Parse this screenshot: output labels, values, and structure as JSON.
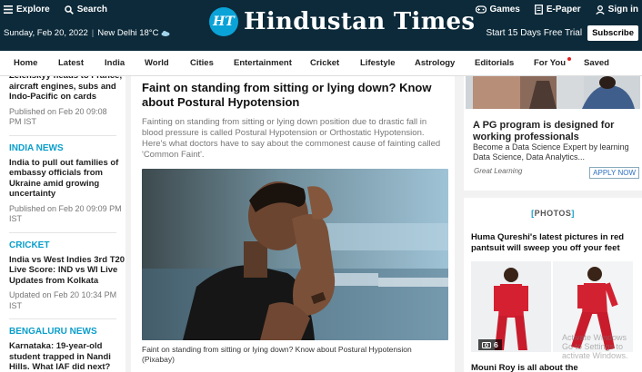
{
  "header": {
    "explore": "Explore",
    "search": "Search",
    "date": "Sunday, Feb 20, 2022",
    "weather": "New Delhi 18°C",
    "logo_mark": "HT",
    "logo_text": "Hindustan Times",
    "games": "Games",
    "epaper": "E-Paper",
    "signin": "Sign in",
    "trial": "Start 15 Days Free Trial",
    "subscribe": "Subscribe"
  },
  "nav": [
    "Home",
    "Latest",
    "India",
    "World",
    "Cities",
    "Entertainment",
    "Cricket",
    "Lifestyle",
    "Astrology",
    "Editorials",
    "For You",
    "Saved"
  ],
  "left": {
    "top_text": "Zelenskyy heads to France,\naircraft engines, subs and\nIndo-Pacific on cards",
    "top_time": "Published on Feb 20 09:08\nPM IST",
    "stories": [
      {
        "cat": "INDIA NEWS",
        "headline": "India to pull out families of embassy officials from Ukraine amid growing uncertainty",
        "time": "Published on Feb 20 09:09 PM IST"
      },
      {
        "cat": "CRICKET",
        "headline": "India vs West Indies 3rd T20 Live Score: IND vs WI Live Updates from Kolkata",
        "time": "Updated on Feb 20 10:34 PM IST"
      },
      {
        "cat": "BENGALURU NEWS",
        "headline": "Karnataka: 19-year-old student trapped in Nandi Hills. What IAF did next?",
        "time": ""
      }
    ]
  },
  "article": {
    "headline": "Faint on standing from sitting or lying down? Know about Postural Hypotension",
    "summary": "Fainting on standing from sitting or lying down position due to drastic fall in blood pressure is called Postural Hypotension or Orthostatic Hypotension. Here's what doctors have to say about the commonest cause of fainting called 'Common Faint'.",
    "caption": "Faint on standing from sitting or lying down? Know about Postural Hypotension (Pixabay)"
  },
  "ad": {
    "title": "A PG program is designed for working professionals",
    "subtitle": "Become a Data Science Expert by learning Data Science, Data Analytics...",
    "brand": "Great Learning",
    "cta": "APPLY NOW"
  },
  "photos": {
    "section": "PHOTOS",
    "headline": "Huma Qureshi's latest pictures in red pantsuit will sweep you off your feet",
    "count": "6",
    "next_headline": "Mouni Roy is all about the"
  },
  "watermark": "Activate Windows\nGo to Settings to activate Windows.",
  "colors": {
    "header_bg": "#0c2a3a",
    "accent": "#0a9ecb",
    "notification": "#e02020"
  }
}
